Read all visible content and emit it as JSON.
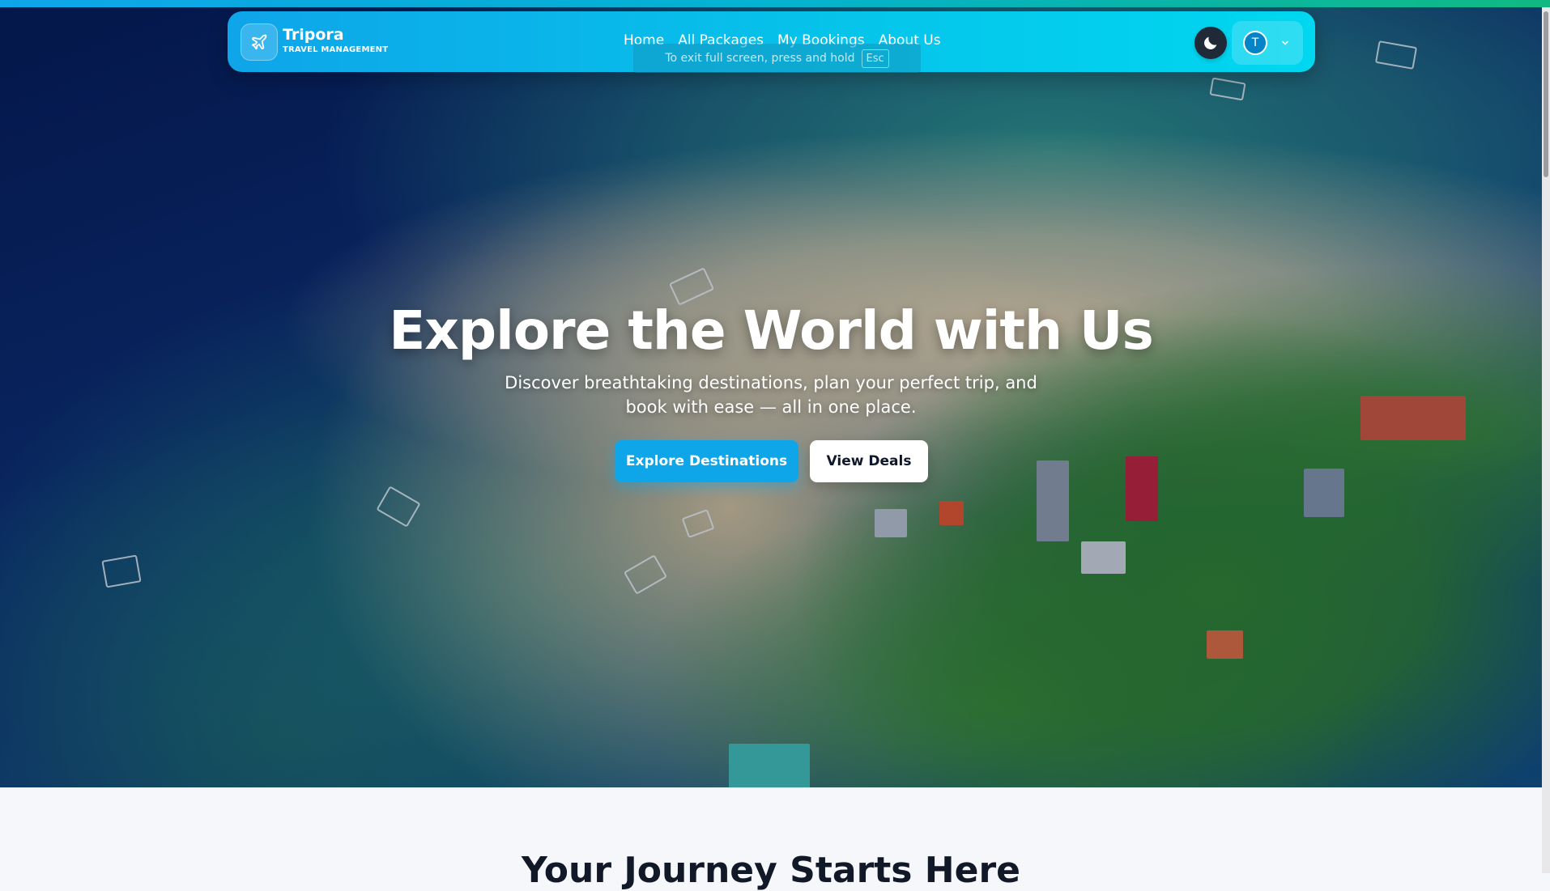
{
  "brand": {
    "name": "Tripora",
    "tagline": "TRAVEL MANAGEMENT"
  },
  "nav": {
    "links": [
      {
        "label": "Home"
      },
      {
        "label": "All Packages"
      },
      {
        "label": "My Bookings"
      },
      {
        "label": "About Us"
      }
    ]
  },
  "fullscreen_hint": {
    "text": "To exit full screen, press and hold",
    "key": "Esc"
  },
  "user": {
    "initial": "T"
  },
  "hero": {
    "title": "Explore the World with Us",
    "subtitle": "Discover breathtaking destinations, plan your perfect trip, and book with ease — all in one place.",
    "primary_cta": "Explore Destinations",
    "secondary_cta": "View Deals"
  },
  "section": {
    "title": "Your Journey Starts Here"
  },
  "icons": {
    "logo": "airplane-icon",
    "theme": "moon-icon",
    "menu": "chevron-down-icon"
  },
  "colors": {
    "accent": "#0ea5e9",
    "navbar_end": "#00d7f0",
    "dark": "#1f2937"
  }
}
